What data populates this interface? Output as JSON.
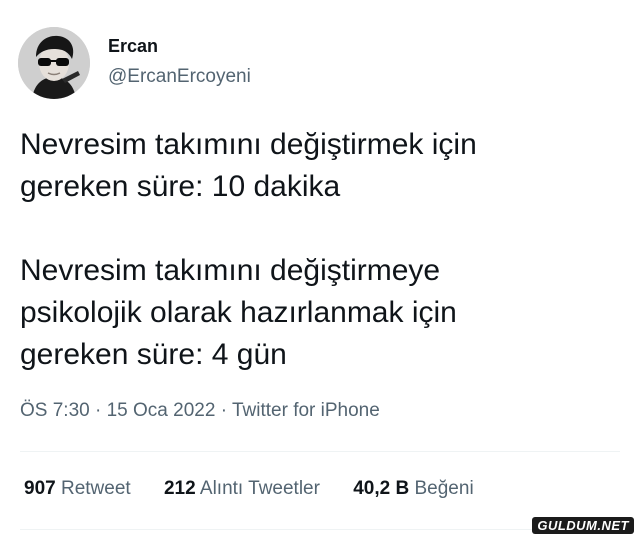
{
  "author": {
    "display_name": "Ercan",
    "handle": "@ErcanErcoyeni",
    "avatar": "profile-photo"
  },
  "tweet": {
    "paragraphs": [
      "Nevresim takımını değiştirmek için\ngereken süre: 10 dakika",
      "Nevresim takımını değiştirmeye\npsikolojik olarak hazırlanmak için\ngereken süre: 4 gün"
    ]
  },
  "meta": {
    "time": "ÖS 7:30",
    "separator": " · ",
    "date": "15 Oca 2022",
    "source": "Twitter for iPhone"
  },
  "stats": {
    "retweets_count": "907",
    "retweets_label": "Retweet",
    "quotes_count": "212",
    "quotes_label": "Alıntı Tweetler",
    "likes_count": "40,2 B",
    "likes_label": "Beğeni"
  },
  "watermark": {
    "text": "GULDUM.NET"
  },
  "colors": {
    "text_primary": "#0f1419",
    "text_secondary": "#536471",
    "divider": "#eff3f4"
  }
}
